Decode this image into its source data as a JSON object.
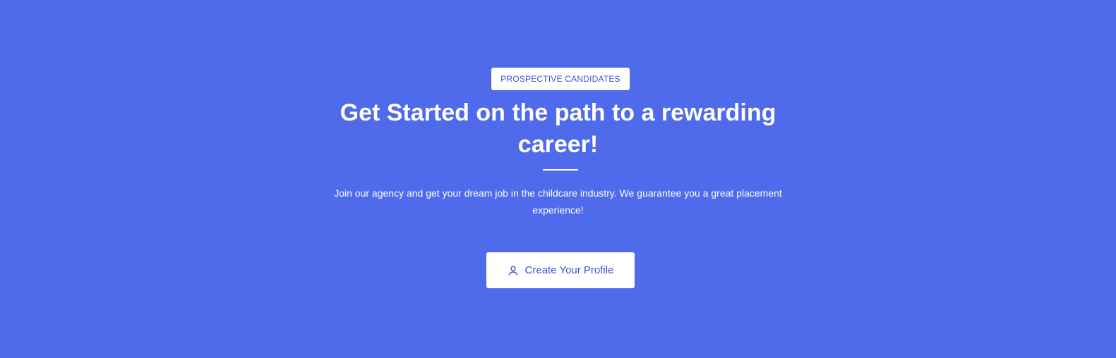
{
  "hero": {
    "badge": "PROSPECTIVE CANDIDATES",
    "title": "Get Started on the path to a rewarding career!",
    "description": "Join our agency and get your dream job in the childcare industry. We guarantee you a great placement experience!",
    "cta": {
      "label": "Create Your Profile",
      "icon": "user-icon"
    }
  },
  "colors": {
    "background": "#4f6aea",
    "accent": "#3b4fd6",
    "text": "#ffffff"
  }
}
